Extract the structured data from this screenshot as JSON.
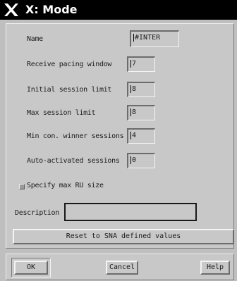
{
  "window": {
    "title": "X: Mode"
  },
  "fields": [
    {
      "label": "Name",
      "value": "#INTER"
    },
    {
      "label": "Receive pacing window",
      "value": "7"
    },
    {
      "label": "Initial session limit",
      "value": "8"
    },
    {
      "label": "Max session limit",
      "value": "8"
    },
    {
      "label": "Min con. winner sessions",
      "value": "4"
    },
    {
      "label": "Auto-activated sessions",
      "value": "0"
    }
  ],
  "specify_ru": {
    "label": "Specify max RU size",
    "checked": false
  },
  "description": {
    "label": "Description",
    "value": ""
  },
  "reset_button": {
    "label": "Reset to SNA defined values"
  },
  "buttons": {
    "ok": "OK",
    "cancel": "Cancel",
    "help": "Help"
  }
}
